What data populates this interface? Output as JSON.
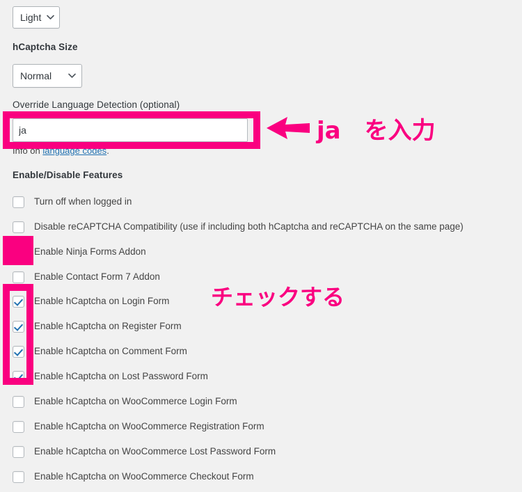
{
  "accent_color": "#fa0080",
  "link_color": "#2271b1",
  "theme_select": {
    "name": "hcaptcha-theme-select",
    "value": "Light",
    "icon": "chevron-down-icon"
  },
  "size_field": {
    "label": "hCaptcha Size",
    "value": "Normal",
    "icon": "chevron-down-icon"
  },
  "override_field": {
    "label": "Override Language Detection (optional)",
    "value": "ja",
    "placeholder": ""
  },
  "info_note": {
    "prefix": "Info on ",
    "link_text": "language codes",
    "suffix": "."
  },
  "features": {
    "heading": "Enable/Disable Features",
    "items": [
      {
        "label": "Turn off when logged in",
        "checked": false
      },
      {
        "label": "Disable reCAPTCHA Compatibility (use if including both hCaptcha and reCAPTCHA on the same page)",
        "checked": false
      },
      {
        "label": "Enable Ninja Forms Addon",
        "checked": true
      },
      {
        "label": "Enable Contact Form 7 Addon",
        "checked": false
      },
      {
        "label": "Enable hCaptcha on Login Form",
        "checked": true
      },
      {
        "label": "Enable hCaptcha on Register Form",
        "checked": true
      },
      {
        "label": "Enable hCaptcha on Comment Form",
        "checked": true
      },
      {
        "label": "Enable hCaptcha on Lost Password Form",
        "checked": true
      },
      {
        "label": "Enable hCaptcha on WooCommerce Login Form",
        "checked": false
      },
      {
        "label": "Enable hCaptcha on WooCommerce Registration Form",
        "checked": false
      },
      {
        "label": "Enable hCaptcha on WooCommerce Lost Password Form",
        "checked": false
      },
      {
        "label": "Enable hCaptcha on WooCommerce Checkout Form",
        "checked": false
      }
    ]
  },
  "annotations": {
    "input_callout": "ja　を入力",
    "checkbox_callout": "チェックする",
    "arrow_icon": "left-arrow-icon"
  }
}
